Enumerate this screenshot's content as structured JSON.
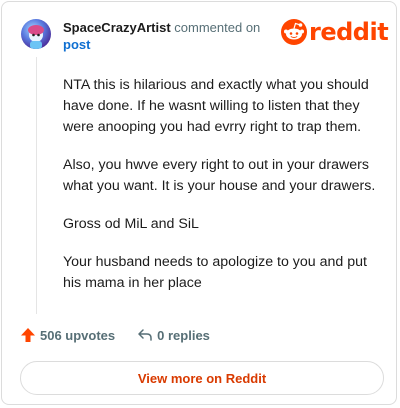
{
  "comment": {
    "author": "SpaceCrazyArtist",
    "action_text": "commented on",
    "post_link": "post",
    "paragraphs": [
      "NTA this is hilarious and exactly what you should have done. If he wasnt willing to listen that they were anooping you had evrry right to trap them.",
      "Also, you hwve every right to out in your drawers what you want. It is your house and your drawers.",
      "Gross od MiL and SiL",
      "Your husband needs to apologize to you and put his mama in her place"
    ],
    "upvotes": "506 upvotes",
    "replies": "0 replies"
  },
  "branding": {
    "logo_text": "reddit",
    "brand_color": "#ff4500"
  },
  "actions": {
    "view_more_label": "View more on Reddit"
  },
  "icons": {
    "avatar": "avatar",
    "upvote": "upvote-arrow-icon",
    "reply": "reply-icon",
    "reddit_logo": "reddit-snoo-icon"
  }
}
